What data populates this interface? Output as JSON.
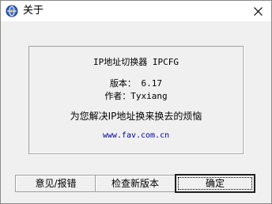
{
  "window": {
    "title": "关于",
    "close_symbol": "×"
  },
  "icons": {
    "app": "app-globe-icon",
    "close": "close-icon"
  },
  "info": {
    "app_name": "IP地址切换器 IPCFG",
    "version": "版本： 6.17",
    "author": "作者：Tyxiang",
    "description": "为您解决IP地址换来换去的烦恼",
    "website": "www.fav.com.cn"
  },
  "buttons": {
    "feedback": "意见/报错",
    "check_update": "检查新版本",
    "ok": "确定"
  },
  "colors": {
    "background": "#f0f0f0",
    "titlebar": "#ffffff",
    "link": "#0000a0",
    "icon_blue": "#1a3f8f"
  }
}
